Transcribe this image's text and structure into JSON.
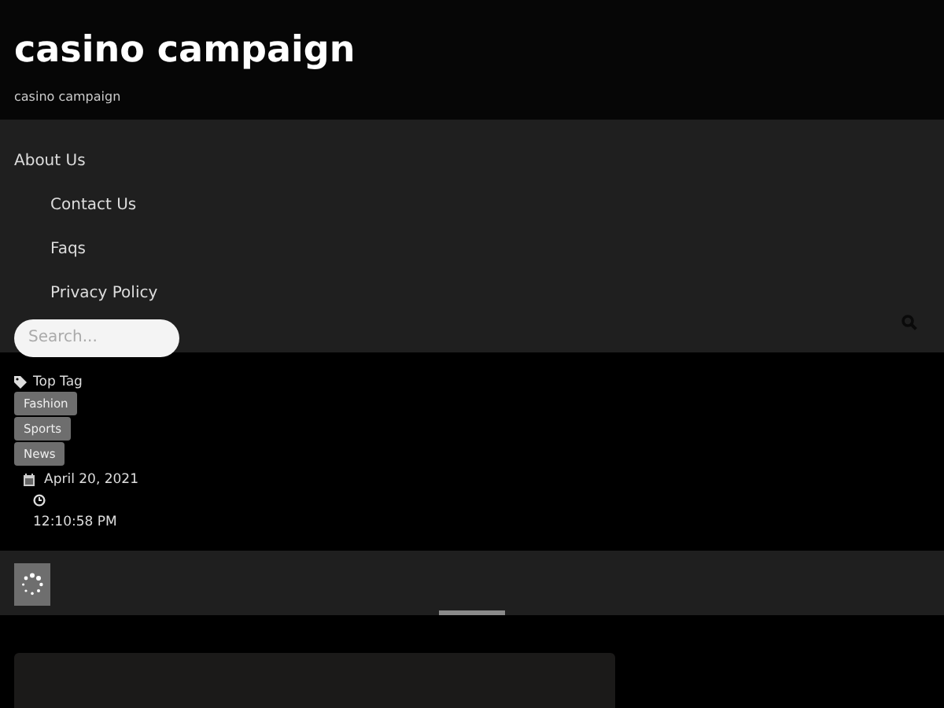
{
  "site": {
    "title": "casino campaign",
    "tagline": "casino campaign"
  },
  "nav": [
    {
      "label": "About Us",
      "children": [
        {
          "label": "Contact Us"
        },
        {
          "label": "Faqs"
        },
        {
          "label": "Privacy Policy"
        }
      ]
    }
  ],
  "search": {
    "placeholder": "Search..."
  },
  "top_tags": {
    "label": "Top Tag",
    "tags": [
      "Fashion",
      "Sports",
      "News"
    ]
  },
  "meta": {
    "date": "April 20, 2021",
    "time": "12:10:58 PM"
  }
}
